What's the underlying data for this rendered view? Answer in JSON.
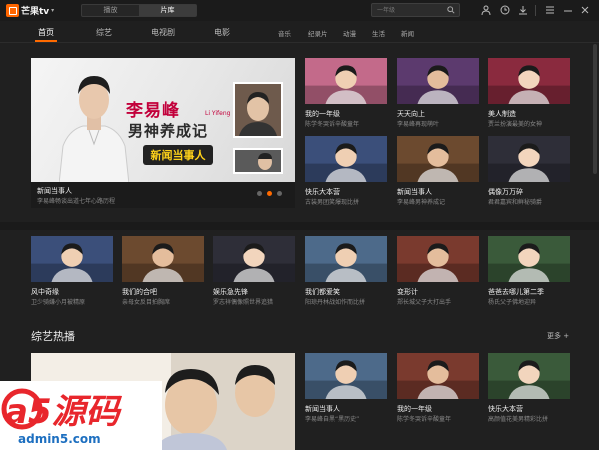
{
  "app": {
    "logo_text": "芒果tv",
    "logo_caret": "▾"
  },
  "top_tabs": [
    {
      "label": "播放"
    },
    {
      "label": "片库"
    }
  ],
  "search": {
    "placeholder": "一年级"
  },
  "nav": {
    "main": [
      {
        "label": "首页"
      },
      {
        "label": "综艺"
      },
      {
        "label": "电视剧"
      },
      {
        "label": "电影"
      }
    ],
    "sub": [
      {
        "label": "音乐"
      },
      {
        "label": "纪录片"
      },
      {
        "label": "动漫"
      },
      {
        "label": "生活"
      },
      {
        "label": "新闻"
      }
    ]
  },
  "banner": {
    "title1": "李易峰",
    "subtitle": "Li Yifeng",
    "title2": "男神养成记",
    "logo_text": "新闻当事人",
    "caption_title": "新闻当事人",
    "caption_sub": "李易峰畅谈出道七年心路历程"
  },
  "top_grid": [
    {
      "title": "我的一年级",
      "sub": "陈学冬哭诉辛酸童年"
    },
    {
      "title": "天天向上",
      "sub": "李易峰再现萌叶"
    },
    {
      "title": "美人制造",
      "sub": "贾兰扮演最美的女神"
    },
    {
      "title": "快乐大本营",
      "sub": "古装男团笑爆现比拼"
    },
    {
      "title": "新闻当事人",
      "sub": "李易峰男神养成记"
    },
    {
      "title": "偶像万万碎",
      "sub": "君君嘉宾和鲜秘骑爵"
    }
  ],
  "row2": [
    {
      "title": "风中奇缘",
      "sub": "卫少骑嫌小月被精原"
    },
    {
      "title": "我们的合吧",
      "sub": "亲母女反目拍胸席"
    },
    {
      "title": "娱乐急先锋",
      "sub": "罗志祥偶像照世界追猎"
    },
    {
      "title": "我们都爱笑",
      "sub": "阳琼丹林战如作而比拼"
    },
    {
      "title": "变形计",
      "sub": "郑长城父子大打出手"
    },
    {
      "title": "爸爸去哪儿第二季",
      "sub": "杨氏父子佛地迎异"
    }
  ],
  "section": {
    "title": "综艺热播",
    "more": "更多 +"
  },
  "row3": [
    {
      "title": "新闻当事人",
      "sub": "李易峰自黑“黑历史”"
    },
    {
      "title": "我的一年级",
      "sub": "陈学冬哭诉辛酸童年"
    },
    {
      "title": "快乐大本营",
      "sub": "高颜值花美男精彩比拼"
    }
  ],
  "watermark": {
    "brand": "a5源码",
    "url": "admin5.com"
  }
}
